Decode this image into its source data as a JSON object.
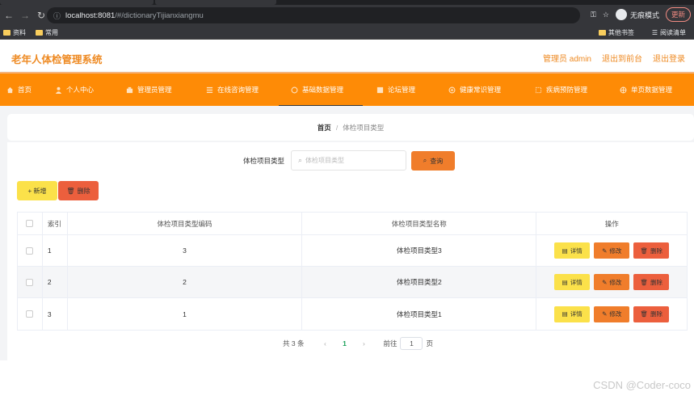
{
  "browser": {
    "url_host": "localhost:8081",
    "url_path": "/#/dictionaryTijianxiangmu",
    "incognito_label": "无痕模式",
    "update_label": "更新",
    "bookmarks": [
      "资料",
      "常用"
    ],
    "bookmarks_right": [
      "其他书签",
      "阅读清单"
    ]
  },
  "header": {
    "title": "老年人体检管理系统",
    "user": "管理员 admin",
    "back_to_front": "退出到前台",
    "logout": "退出登录"
  },
  "nav": [
    {
      "label": "首页",
      "icon": "home-icon"
    },
    {
      "label": "个人中心",
      "icon": "user-icon"
    },
    {
      "label": "管理员管理",
      "icon": "admin-icon"
    },
    {
      "label": "在线咨询管理",
      "icon": "list-icon"
    },
    {
      "label": "基础数据管理",
      "icon": "data-icon",
      "active": true
    },
    {
      "label": "论坛管理",
      "icon": "forum-icon"
    },
    {
      "label": "健康常识管理",
      "icon": "health-icon"
    },
    {
      "label": "疾病预防管理",
      "icon": "prevent-icon"
    },
    {
      "label": "单页数据管理",
      "icon": "page-icon"
    }
  ],
  "breadcrumb": {
    "home": "首页",
    "separator": "/",
    "current": "体检项目类型"
  },
  "search": {
    "label": "体检项目类型",
    "placeholder": "体检项目类型",
    "button": "查询"
  },
  "actions": {
    "add": "+ 新增",
    "delete": "删除"
  },
  "table": {
    "columns": [
      "索引",
      "体检项目类型编码",
      "体检项目类型名称",
      "操作"
    ],
    "rows": [
      {
        "index": "1",
        "code": "3",
        "name": "体检项目类型3"
      },
      {
        "index": "2",
        "code": "2",
        "name": "体检项目类型2"
      },
      {
        "index": "3",
        "code": "1",
        "name": "体检项目类型1"
      }
    ],
    "ops": {
      "detail": "详情",
      "edit": "修改",
      "remove": "删除"
    }
  },
  "pagination": {
    "total": "共 3 条",
    "prev": "‹",
    "page": "1",
    "next": "›",
    "goto": "前往",
    "jump_value": "1",
    "suffix": "页"
  },
  "watermark": "CSDN @Coder-coco",
  "colors": {
    "primary": "#fe8b06",
    "title": "#ee8a23",
    "warning": "#fbe14a",
    "danger": "#ec5f3d",
    "accent": "#f07d2b"
  }
}
